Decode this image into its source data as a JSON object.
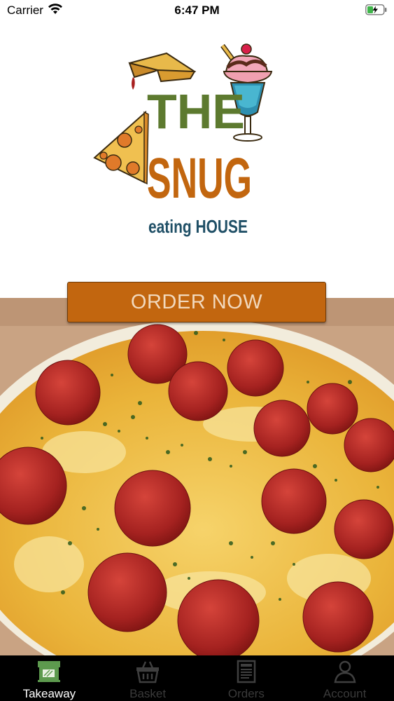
{
  "status_bar": {
    "carrier": "Carrier",
    "time": "6:47 PM"
  },
  "logo": {
    "line1": "THE",
    "line2": "SNUG",
    "line3": "eating HOUSE",
    "colors": {
      "the": "#5d7a2f",
      "snug": "#c2660f",
      "eating_house": "#1f4f66"
    }
  },
  "order_button": {
    "label": "ORDER NOW",
    "color": "#c2660f"
  },
  "tabs": [
    {
      "label": "Takeaway",
      "icon": "storefront-icon",
      "active": true
    },
    {
      "label": "Basket",
      "icon": "basket-icon",
      "active": false
    },
    {
      "label": "Orders",
      "icon": "receipt-icon",
      "active": false
    },
    {
      "label": "Account",
      "icon": "person-icon",
      "active": false
    }
  ]
}
